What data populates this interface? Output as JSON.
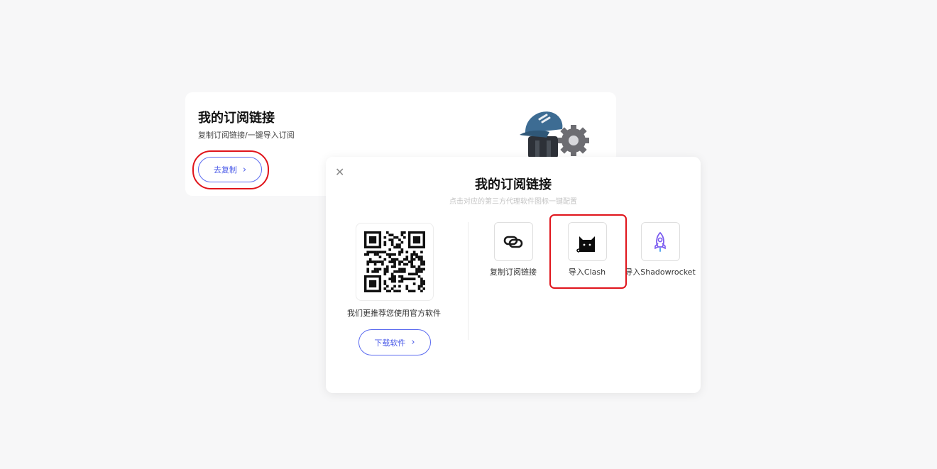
{
  "card": {
    "title": "我的订阅链接",
    "subtitle": "复制订阅链接/一键导入订阅",
    "copy_button": "去复制"
  },
  "modal": {
    "title": "我的订阅链接",
    "subtitle": "点击对应的第三方代理软件图标一键配置",
    "qr_caption": "我们更推荐您使用官方软件",
    "download_button": "下载软件",
    "apps": [
      {
        "label": "复制订阅链接",
        "icon": "link-icon"
      },
      {
        "label": "导入Clash",
        "icon": "clash-cat-icon"
      },
      {
        "label": "导入Shadowrocket",
        "icon": "rocket-icon"
      }
    ]
  },
  "colors": {
    "accent": "#4a5ae8",
    "highlight": "#e0141b",
    "background": "#f7f7f8"
  }
}
